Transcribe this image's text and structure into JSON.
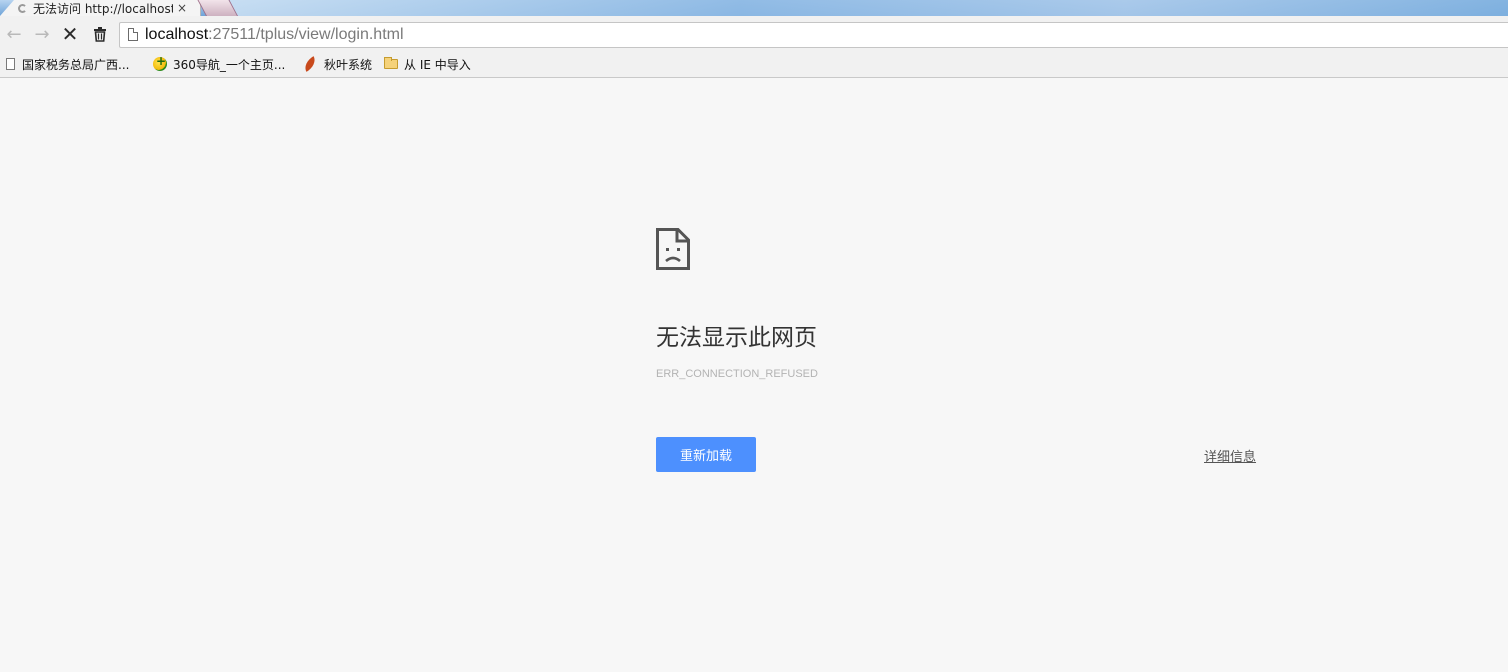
{
  "tab": {
    "title": "无法访问 http://localhost",
    "close_glyph": "×"
  },
  "toolbar": {
    "back_glyph": "←",
    "forward_glyph": "→",
    "stop_glyph": "✕",
    "trash_icon": "trash-icon"
  },
  "omnibox": {
    "url_host": "localhost",
    "url_rest": ":27511/tplus/view/login.html"
  },
  "bookmarks": [
    {
      "label": "国家税务总局广西...",
      "icon": "page-icon"
    },
    {
      "label": "360导航_一个主页...",
      "icon": "360-icon"
    },
    {
      "label": "秋叶系统",
      "icon": "leaf-icon"
    },
    {
      "label": "从 IE 中导入",
      "icon": "folder-icon"
    }
  ],
  "error": {
    "title": "无法显示此网页",
    "code": "ERR_CONNECTION_REFUSED",
    "reload_label": "重新加载",
    "details_label": "详细信息"
  },
  "colors": {
    "page_bg": "#f7f7f7",
    "button_blue": "#4d90fe",
    "toolbar_bg": "#f1f1f1"
  }
}
